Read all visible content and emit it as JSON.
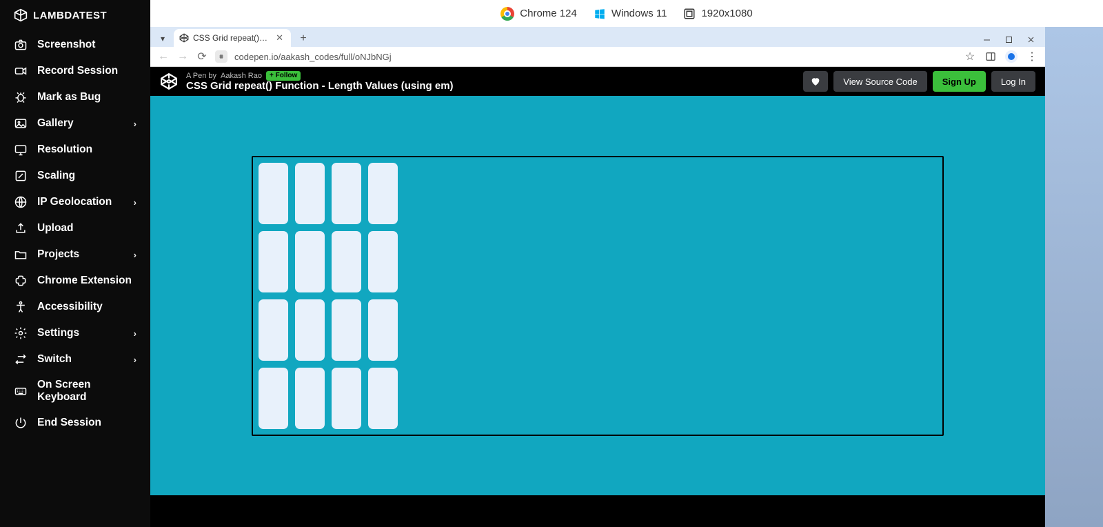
{
  "brand": "LAMBDATEST",
  "sidebar": {
    "items": [
      {
        "label": "Screenshot",
        "chevron": false
      },
      {
        "label": "Record Session",
        "chevron": false
      },
      {
        "label": "Mark as Bug",
        "chevron": false
      },
      {
        "label": "Gallery",
        "chevron": true
      },
      {
        "label": "Resolution",
        "chevron": false
      },
      {
        "label": "Scaling",
        "chevron": false
      },
      {
        "label": "IP Geolocation",
        "chevron": true
      },
      {
        "label": "Upload",
        "chevron": false
      },
      {
        "label": "Projects",
        "chevron": true
      },
      {
        "label": "Chrome Extension",
        "chevron": false
      },
      {
        "label": "Accessibility",
        "chevron": false
      },
      {
        "label": "Settings",
        "chevron": true
      },
      {
        "label": "Switch",
        "chevron": true
      },
      {
        "label": "On Screen Keyboard",
        "chevron": false
      },
      {
        "label": "End Session",
        "chevron": false
      }
    ]
  },
  "info": {
    "browser": "Chrome 124",
    "os": "Windows 11",
    "resolution": "1920x1080"
  },
  "tab": {
    "title": "CSS Grid repeat() Function - L…"
  },
  "url": "codepen.io/aakash_codes/full/oNJbNGj",
  "codepen": {
    "byline_prefix": "A Pen by",
    "author": "Aakash Rao",
    "follow": "+ Follow",
    "title": "CSS Grid repeat() Function - Length Values (using em)",
    "view_source": "View Source Code",
    "signup": "Sign Up",
    "login": "Log In"
  },
  "grid": {
    "cells": 16
  }
}
